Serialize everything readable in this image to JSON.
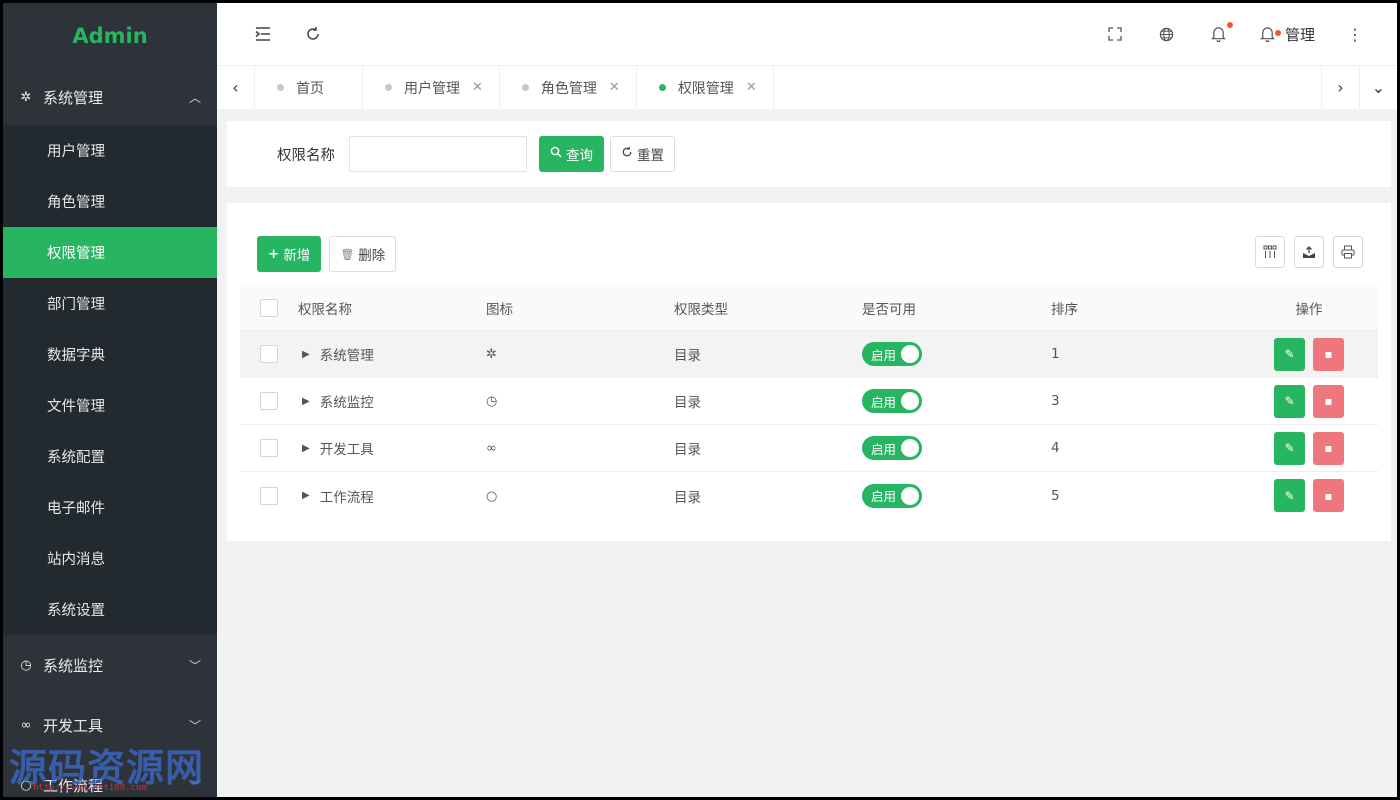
{
  "app": {
    "title": "Admin"
  },
  "sidebar": {
    "groups": [
      {
        "label": "系统管理",
        "icon": "gear-icon",
        "expanded": true,
        "items": [
          {
            "label": "用户管理"
          },
          {
            "label": "角色管理"
          },
          {
            "label": "权限管理",
            "active": true
          },
          {
            "label": "部门管理"
          },
          {
            "label": "数据字典"
          },
          {
            "label": "文件管理"
          },
          {
            "label": "系统配置"
          },
          {
            "label": "电子邮件"
          },
          {
            "label": "站内消息"
          },
          {
            "label": "系统设置"
          }
        ]
      },
      {
        "label": "系统监控",
        "icon": "dashboard-icon",
        "expanded": false
      },
      {
        "label": "开发工具",
        "icon": "infinity-icon",
        "expanded": false
      },
      {
        "label": "工作流程",
        "icon": "circle-icon",
        "expanded": false
      }
    ]
  },
  "topbar": {
    "user_label": "管理"
  },
  "tabs": [
    {
      "label": "首页",
      "active": false,
      "closable": false
    },
    {
      "label": "用户管理",
      "active": false,
      "closable": true
    },
    {
      "label": "角色管理",
      "active": false,
      "closable": true
    },
    {
      "label": "权限管理",
      "active": true,
      "closable": true
    }
  ],
  "search": {
    "label": "权限名称",
    "value": "",
    "placeholder": "",
    "query_label": "查询",
    "reset_label": "重置"
  },
  "toolbar": {
    "add_label": "新增",
    "delete_label": "删除"
  },
  "table": {
    "columns": [
      "权限名称",
      "图标",
      "权限类型",
      "是否可用",
      "排序",
      "操作"
    ],
    "rows": [
      {
        "name": "系统管理",
        "icon": "gear-icon",
        "icon_glyph": "✲",
        "type": "目录",
        "status": "启用",
        "sort": "1"
      },
      {
        "name": "系统监控",
        "icon": "dashboard-icon",
        "icon_glyph": "◷",
        "type": "目录",
        "status": "启用",
        "sort": "3"
      },
      {
        "name": "开发工具",
        "icon": "infinity-icon",
        "icon_glyph": "∞",
        "type": "目录",
        "status": "启用",
        "sort": "4"
      },
      {
        "name": "工作流程",
        "icon": "circle-icon",
        "icon_glyph": "○",
        "type": "目录",
        "status": "启用",
        "sort": "5"
      }
    ]
  },
  "watermark": {
    "text": "源码资源网",
    "sub": "http://www.net188.com"
  },
  "colors": {
    "primary": "#27b562",
    "danger": "#f0767d",
    "sidebar": "#2d3338",
    "sidebar_sub": "#232a2f"
  }
}
